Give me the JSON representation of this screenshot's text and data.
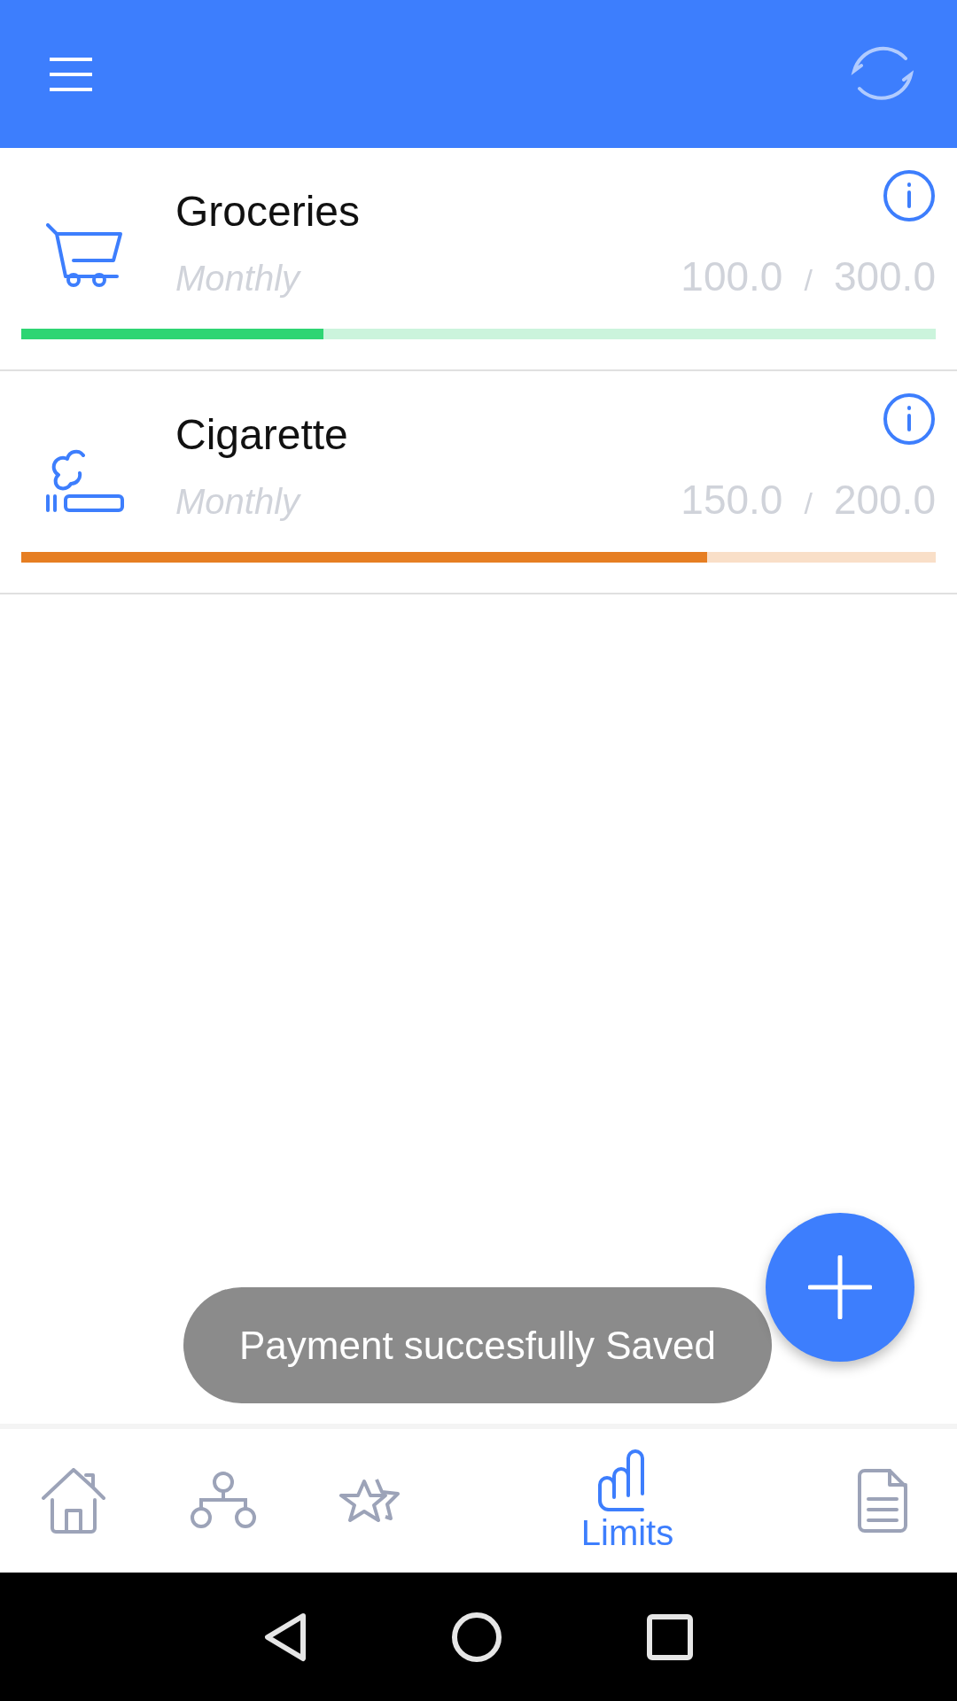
{
  "limits": [
    {
      "kind": "cart",
      "title": "Groceries",
      "period": "Monthly",
      "spent": "100.0",
      "separator": "/",
      "limit": "300.0",
      "level": 0.33,
      "color": "#2ed573"
    },
    {
      "kind": "smoking",
      "title": "Cigarette",
      "period": "Monthly",
      "spent": "150.0",
      "separator": "/",
      "limit": "200.0",
      "level": 0.75,
      "color": "#e67e22"
    }
  ],
  "toast": "Payment succesfully Saved",
  "nav": [
    {
      "kind": "home",
      "selected": false
    },
    {
      "kind": "tree",
      "selected": false
    },
    {
      "kind": "stars",
      "selected": false
    },
    {
      "kind": "chart",
      "label": "Limits",
      "selected": true
    },
    {
      "kind": "document",
      "selected": false
    }
  ]
}
